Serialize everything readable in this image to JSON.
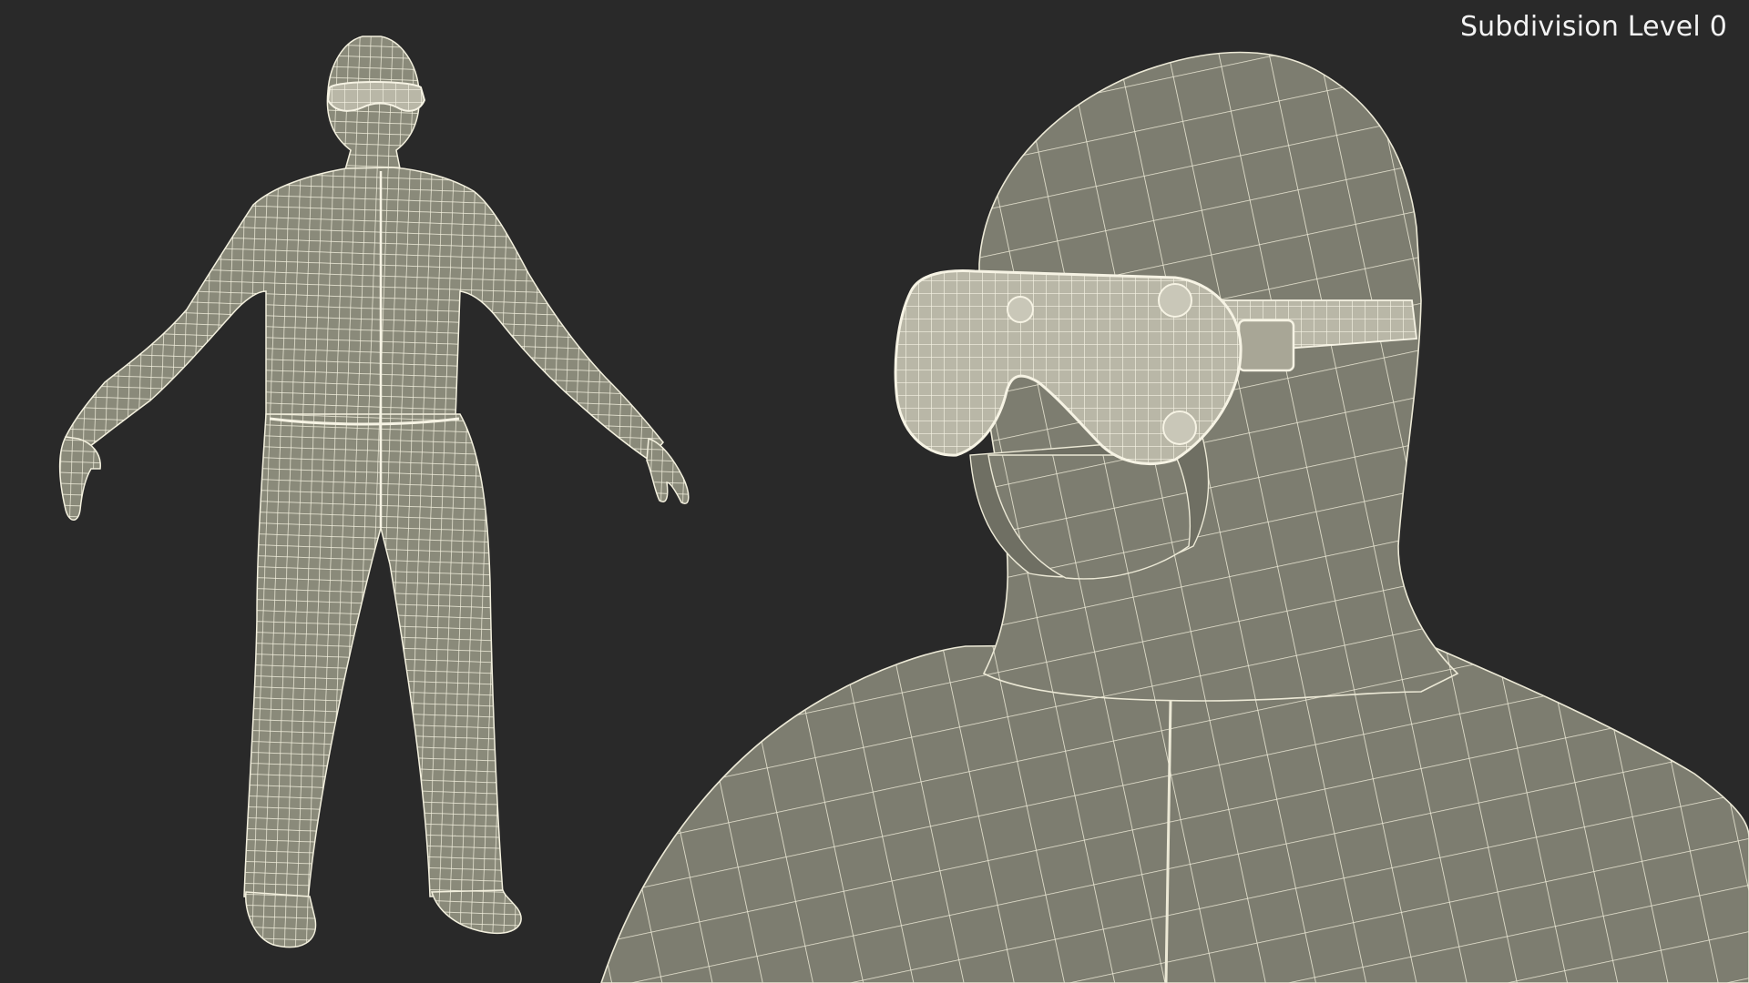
{
  "overlay": {
    "subdivision_label": "Subdivision Level 0"
  },
  "scene": {
    "background_color": "#292929",
    "mesh_fill_full_body": "#8a8a7a",
    "mesh_fill_closeup": "#7d7d70",
    "wire_color": "#f3f0de",
    "subject": "hazmat-suit-with-goggles",
    "views": [
      "full-body-front",
      "head-closeup"
    ]
  }
}
